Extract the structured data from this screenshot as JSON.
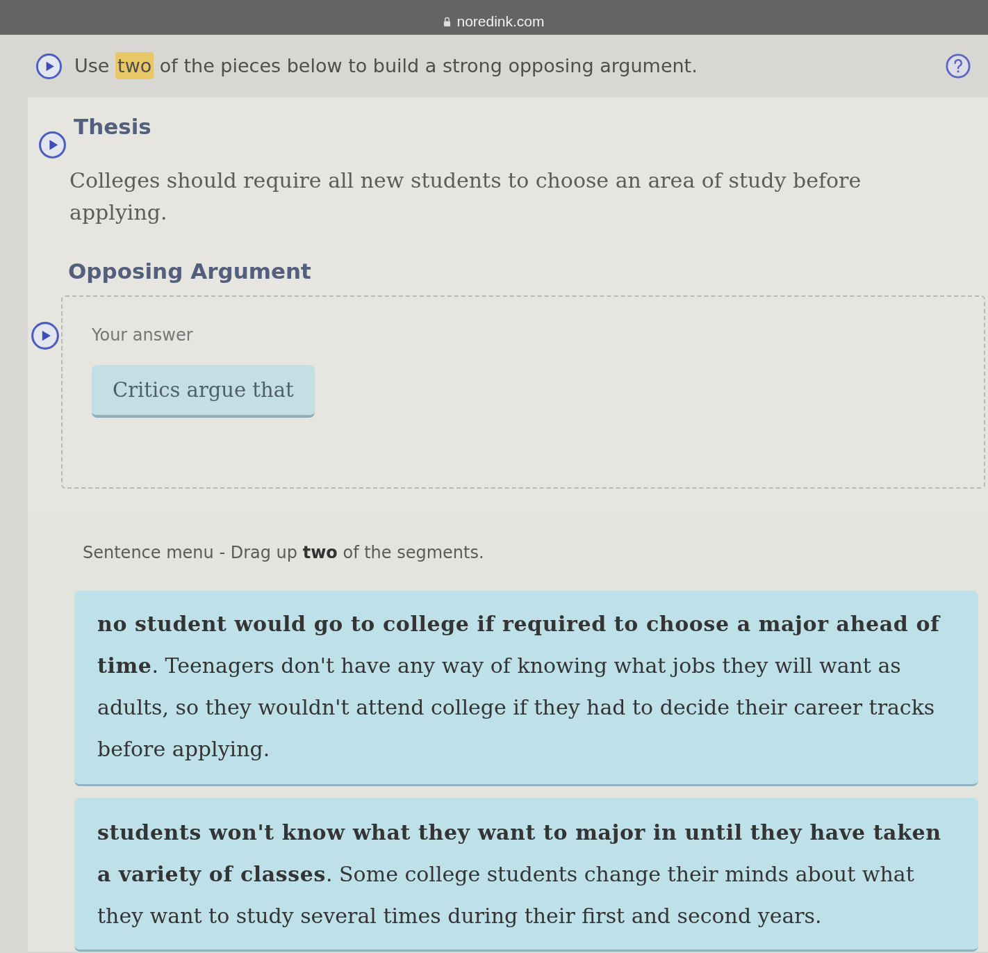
{
  "browser_bar": {
    "address": "noredink.com"
  },
  "instruction": {
    "parts": [
      {
        "text": "Use",
        "highlighted": false
      },
      {
        "text": "two",
        "highlighted": true
      },
      {
        "text": "of the pieces below to build a strong opposing argument.",
        "highlighted": false
      }
    ]
  },
  "thesis": {
    "heading": "Thesis",
    "text": "Colleges should require all new students to choose an area of study before applying."
  },
  "opposing_argument": {
    "heading": "Opposing Argument",
    "answer_label": "Your answer",
    "answer_pieces": [
      "Critics argue that"
    ]
  },
  "sentence_menu": {
    "instructions": "Sentence menu - Drag up **two** of the segments.",
    "segments": [
      "**no student would go to college if required to choose a major ahead of time**. Teenagers don't have any way of knowing what jobs they will want as adults, so they wouldn't attend college if they had to decide their career tracks before applying.",
      "**students won't know what they want to major in until they have taken a variety of classes**. Some college students change their minds about what they want to study several times during their first and second years."
    ]
  }
}
